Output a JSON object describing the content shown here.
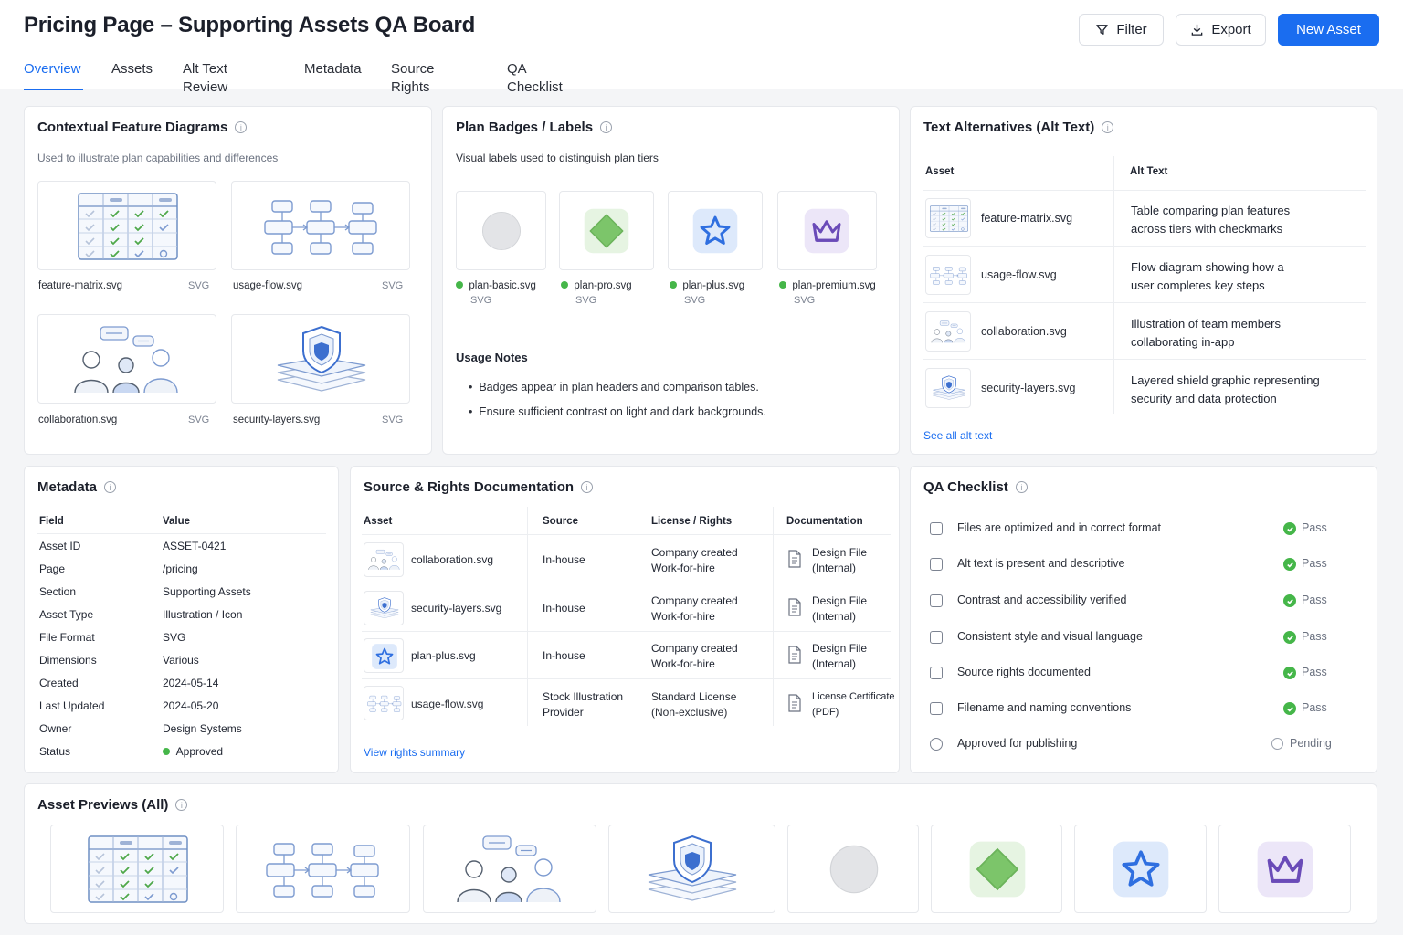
{
  "header": {
    "title": "Pricing Page – Supporting Assets QA Board",
    "filter_label": "Filter",
    "export_label": "Export",
    "new_asset_label": "New Asset"
  },
  "tabs": [
    {
      "label": "Overview",
      "active": true
    },
    {
      "label": "Assets"
    },
    {
      "label": "Alt Text Review"
    },
    {
      "label": "Metadata"
    },
    {
      "label": "Source Rights"
    },
    {
      "label": "QA Checklist"
    }
  ],
  "diagrams": {
    "title": "Contextual Feature Diagrams",
    "subtitle": "Used to illustrate plan capabilities and differences",
    "items": [
      {
        "name": "feature-matrix.svg",
        "type": "SVG",
        "icon": "feature-matrix-illustration"
      },
      {
        "name": "usage-flow.svg",
        "type": "SVG",
        "icon": "usage-flow-illustration"
      },
      {
        "name": "collaboration.svg",
        "type": "SVG",
        "icon": "collaboration-illustration"
      },
      {
        "name": "security-layers.svg",
        "type": "SVG",
        "icon": "security-layers-illustration"
      }
    ]
  },
  "badges": {
    "title": "Plan Badges / Labels",
    "subtitle": "Visual labels used to distinguish plan tiers",
    "items": [
      {
        "name": "plan-basic.svg",
        "type": "SVG",
        "icon": "circle-badge-icon"
      },
      {
        "name": "plan-pro.svg",
        "type": "SVG",
        "icon": "diamond-badge-icon"
      },
      {
        "name": "plan-plus.svg",
        "type": "SVG",
        "icon": "star-badge-icon"
      },
      {
        "name": "plan-premium.svg",
        "type": "SVG",
        "icon": "crown-badge-icon"
      }
    ],
    "notes_title": "Usage Notes",
    "notes": [
      "Badges appear in plan headers and comparison tables.",
      "Ensure sufficient contrast on light and dark backgrounds."
    ]
  },
  "alt_text": {
    "title": "Text Alternatives (Alt Text)",
    "col_asset": "Asset",
    "col_alt": "Alt Text",
    "rows": [
      {
        "asset": "feature-matrix.svg",
        "line1": "Table comparing plan features",
        "line2": "across tiers with checkmarks"
      },
      {
        "asset": "usage-flow.svg",
        "line1": "Flow diagram showing how a",
        "line2": "user completes key steps"
      },
      {
        "asset": "collaboration.svg",
        "line1": "Illustration of team members",
        "line2": "collaborating in-app"
      },
      {
        "asset": "security-layers.svg",
        "line1": "Layered shield graphic representing",
        "line2": "security and data protection"
      }
    ],
    "see_all": "See all alt text"
  },
  "metadata": {
    "title": "Metadata",
    "col_field": "Field",
    "col_value": "Value",
    "rows": [
      {
        "field": "Asset ID",
        "value": "ASSET-0421"
      },
      {
        "field": "Page",
        "value": "/pricing"
      },
      {
        "field": "Section",
        "value": "Supporting Assets"
      },
      {
        "field": "Asset Type",
        "value": "Illustration / Icon"
      },
      {
        "field": "File Format",
        "value": "SVG"
      },
      {
        "field": "Dimensions",
        "value": "Various"
      },
      {
        "field": "Created",
        "value": "2024-05-14"
      },
      {
        "field": "Last Updated",
        "value": "2024-05-20"
      },
      {
        "field": "Owner",
        "value": "Design Systems"
      },
      {
        "field": "Status",
        "value": "Approved"
      }
    ]
  },
  "rights": {
    "title": "Source & Rights Documentation",
    "col_asset": "Asset",
    "col_source": "Source",
    "col_license": "License / Rights",
    "col_doc": "Documentation",
    "rows": [
      {
        "asset": "collaboration.svg",
        "source1": "In-house",
        "source2": "",
        "lic1": "Company created",
        "lic2": "Work-for-hire",
        "doc1": "Design File",
        "doc2": "(Internal)"
      },
      {
        "asset": "security-layers.svg",
        "source1": "In-house",
        "source2": "",
        "lic1": "Company created",
        "lic2": "Work-for-hire",
        "doc1": "Design File",
        "doc2": "(Internal)"
      },
      {
        "asset": "plan-plus.svg",
        "source1": "In-house",
        "source2": "",
        "lic1": "Company created",
        "lic2": "Work-for-hire",
        "doc1": "Design File",
        "doc2": "(Internal)"
      },
      {
        "asset": "usage-flow.svg",
        "source1": "Stock Illustration",
        "source2": "Provider",
        "lic1": "Standard License",
        "lic2": "(Non-exclusive)",
        "doc1": "License Certificate",
        "doc2": "(PDF)"
      }
    ],
    "view_summary": "View rights summary"
  },
  "qa": {
    "title": "QA Checklist",
    "items": [
      {
        "label": "Files are optimized and in correct format",
        "status": "Pass"
      },
      {
        "label": "Alt text is present and descriptive",
        "status": "Pass"
      },
      {
        "label": "Contrast and accessibility verified",
        "status": "Pass"
      },
      {
        "label": "Consistent style and visual language",
        "status": "Pass"
      },
      {
        "label": "Source rights documented",
        "status": "Pass"
      },
      {
        "label": "Filename and naming conventions",
        "status": "Pass"
      },
      {
        "label": "Approved for publishing",
        "status": "Pending"
      }
    ]
  },
  "previews": {
    "title": "Asset Previews (All)"
  },
  "colors": {
    "accent": "#1a6df0",
    "pass": "#45b649",
    "pro_green": "#7cc56a",
    "plus_blue": "#2f6fe0",
    "premium_purple": "#6a4bb8"
  }
}
